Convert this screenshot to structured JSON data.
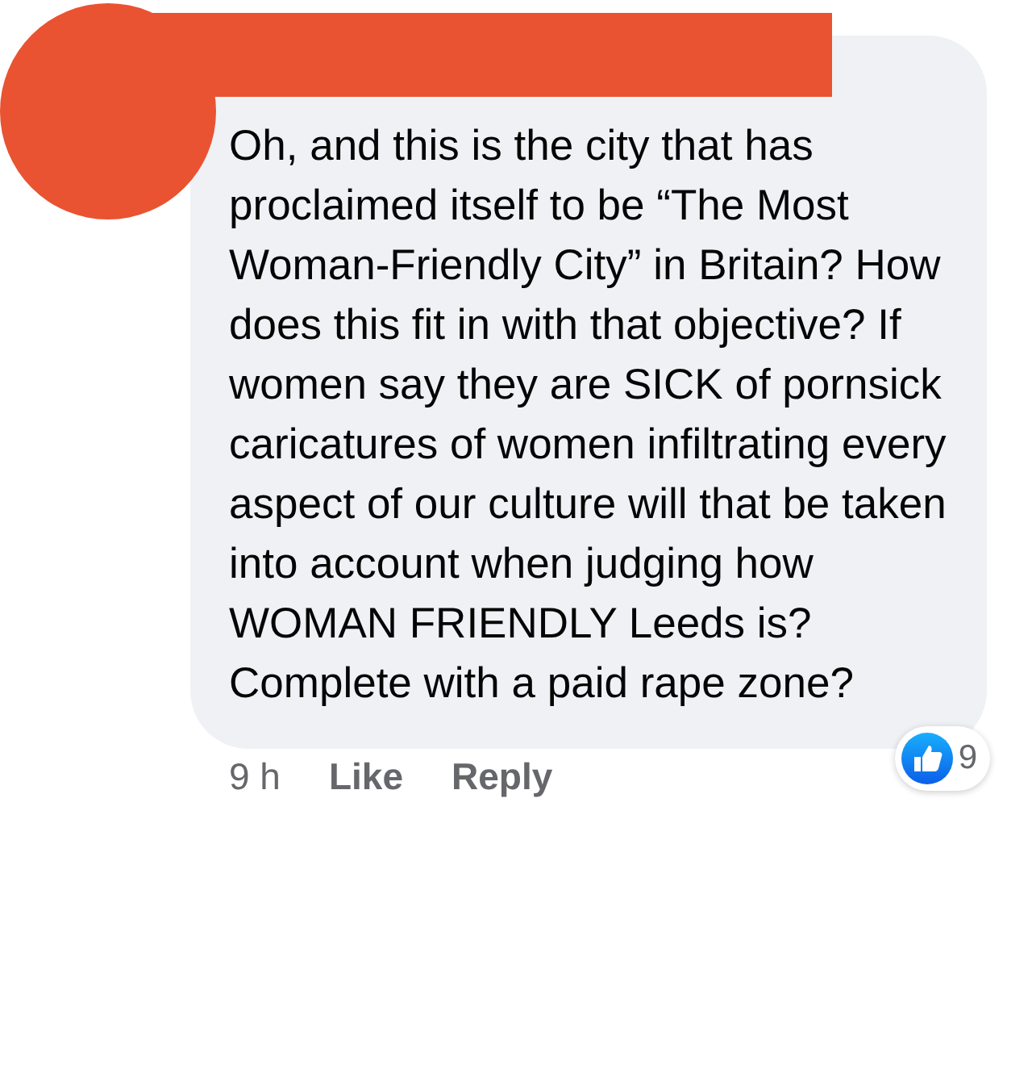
{
  "comment": {
    "text": "Oh, and this is the city that has proclaimed itself to be “The Most Woman-Friendly City” in Britain? How does this fit in with that objective? If women say they are SICK of pornsick caricatures of women infiltrating every aspect of our culture will that be taken into account when judging how WOMAN FRIENDLY Leeds is? Complete with a paid rape zone?",
    "time": "9 h",
    "actions": [
      "Like",
      "Reply"
    ],
    "reaction_count": "9"
  }
}
